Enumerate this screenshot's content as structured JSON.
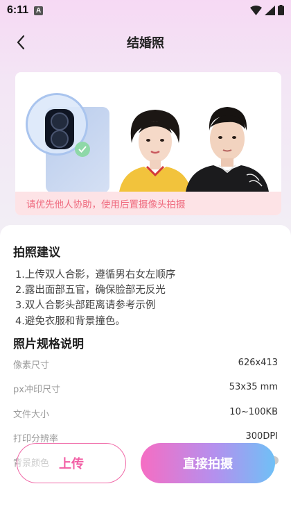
{
  "status_bar": {
    "time": "6:11",
    "app_badge": "A",
    "icons": [
      "wifi-icon",
      "signal-icon",
      "battery-icon"
    ]
  },
  "header": {
    "title": "结婚照",
    "back_icon": "chevron-left-icon"
  },
  "example": {
    "hint": "请优先他人协助，使用后置摄像头拍摄"
  },
  "tips": {
    "title": "拍照建议",
    "items": [
      "1.上传双人合影，遵循男右女左顺序",
      "2.露出面部五官，确保脸部无反光",
      "3.双人合影头部距离请参考示例",
      "4.避免衣服和背景撞色。"
    ]
  },
  "specs": {
    "title": "照片规格说明",
    "rows": [
      {
        "label": "像素尺寸",
        "value": "626x413"
      },
      {
        "label": "px冲印尺寸",
        "value": "53x35 mm"
      },
      {
        "label": "文件大小",
        "value": "10~100KB"
      },
      {
        "label": "打印分辨率",
        "value": "300DPI"
      },
      {
        "label": "背景颜色",
        "value": ""
      }
    ]
  },
  "actions": {
    "upload_label": "上传",
    "shoot_label": "直接拍摄"
  },
  "colors": {
    "accent_pink": "#f25fa5",
    "hint_text": "#ef6b7f",
    "hint_bg": "#fde3e6",
    "gradient_start": "#f66dc3",
    "gradient_end": "#6fc0f6"
  }
}
